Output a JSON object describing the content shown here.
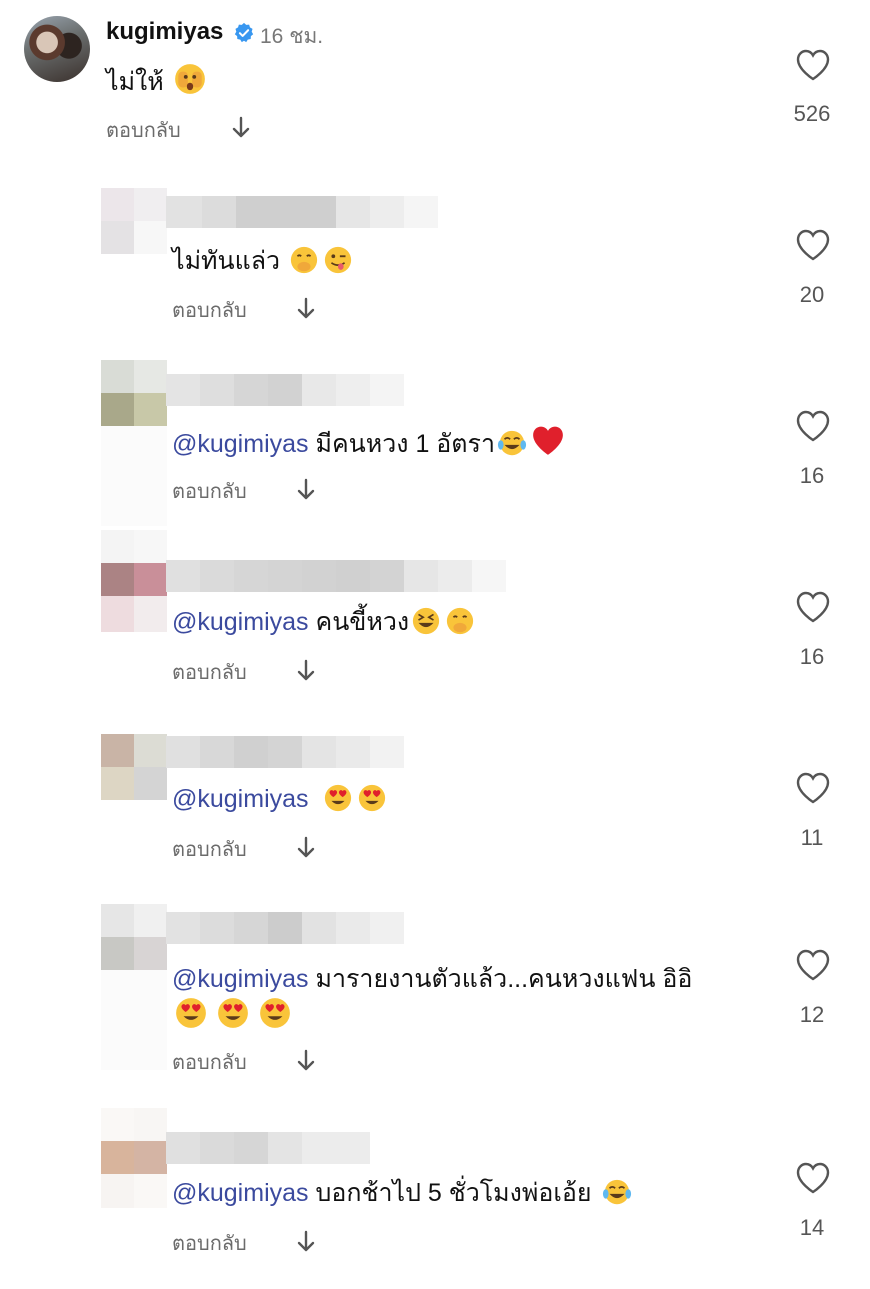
{
  "main_comment": {
    "username": "kugimiyas",
    "time": "16 ชม.",
    "text": "ไม่ให้",
    "emoji": [
      "shocked-peek-emoji"
    ],
    "reply_label": "ตอบกลับ",
    "likes": "526"
  },
  "replies": [
    {
      "mention": "",
      "text": "ไม่ทันแล่ว",
      "emoji": [
        "hand-over-mouth-emoji",
        "winking-tongue-emoji"
      ],
      "reply_label": "ตอบกลับ",
      "likes": "20"
    },
    {
      "mention": "@kugimiyas",
      "text": " มีคนหวง 1 อัตรา",
      "emoji": [
        "tears-of-joy-emoji",
        "red-heart-emoji"
      ],
      "reply_label": "ตอบกลับ",
      "likes": "16"
    },
    {
      "mention": "@kugimiyas",
      "text": " คนขี้หวง",
      "emoji": [
        "grinning-squint-emoji",
        "hand-over-mouth-emoji"
      ],
      "reply_label": "ตอบกลับ",
      "likes": "16"
    },
    {
      "mention": "@kugimiyas",
      "text": " ",
      "emoji": [
        "heart-eyes-emoji",
        "heart-eyes-emoji"
      ],
      "reply_label": "ตอบกลับ",
      "likes": "11"
    },
    {
      "mention": "@kugimiyas",
      "text": " มารายงานตัวแล้ว...คนหวงแฟน อิอิ",
      "emoji": [
        "heart-eyes-emoji",
        "heart-eyes-emoji",
        "heart-eyes-emoji"
      ],
      "reply_label": "ตอบกลับ",
      "likes": "12"
    },
    {
      "mention": "@kugimiyas",
      "text": " บอกช้าไป 5 ชั่วโมงพ่อเอ้ย",
      "emoji": [
        "tears-of-joy-emoji"
      ],
      "reply_label": "ตอบกลับ",
      "likes": "14"
    }
  ],
  "colors": {
    "mention": "#3b4a9e",
    "verified": "#3897f0",
    "muted": "#6b6b6b"
  }
}
